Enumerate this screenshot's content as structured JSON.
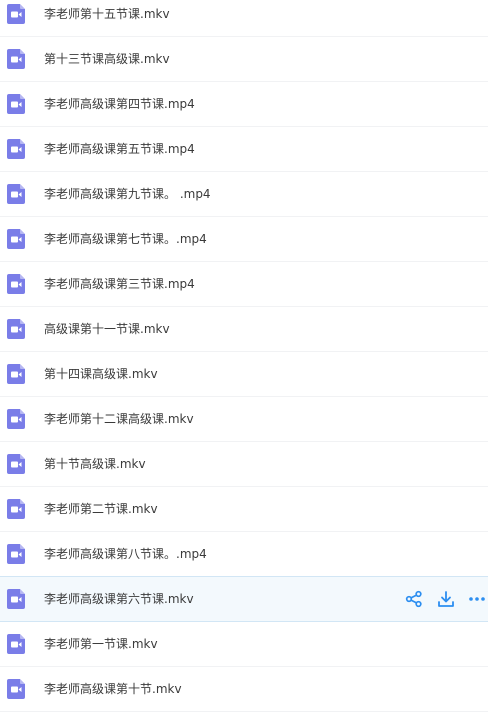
{
  "colors": {
    "file_icon": "#7a7de8",
    "action_icon": "#2c8ef0",
    "row_highlight_bg": "#f3f9fd",
    "row_highlight_border": "#d2e6f5",
    "text": "#3a3a3a"
  },
  "files": [
    {
      "name": "李老师第十五节课.mkv",
      "icon": "video-file-icon"
    },
    {
      "name": "第十三节课高级课.mkv",
      "icon": "video-file-icon"
    },
    {
      "name": "李老师高级课第四节课.mp4",
      "icon": "video-file-icon"
    },
    {
      "name": "李老师高级课第五节课.mp4",
      "icon": "video-file-icon"
    },
    {
      "name": "李老师高级课第九节课。 .mp4",
      "icon": "video-file-icon"
    },
    {
      "name": "李老师高级课第七节课。.mp4",
      "icon": "video-file-icon"
    },
    {
      "name": "李老师高级课第三节课.mp4",
      "icon": "video-file-icon"
    },
    {
      "name": "高级课第十一节课.mkv",
      "icon": "video-file-icon"
    },
    {
      "name": "第十四课高级课.mkv",
      "icon": "video-file-icon"
    },
    {
      "name": "李老师第十二课高级课.mkv",
      "icon": "video-file-icon"
    },
    {
      "name": "第十节高级课.mkv",
      "icon": "video-file-icon"
    },
    {
      "name": "李老师第二节课.mkv",
      "icon": "video-file-icon"
    },
    {
      "name": "李老师高级课第八节课。.mp4",
      "icon": "video-file-icon"
    },
    {
      "name": "李老师高级课第六节课.mkv",
      "icon": "video-file-icon",
      "hovered": true,
      "actions": [
        "share-icon",
        "download-icon",
        "more-icon"
      ]
    },
    {
      "name": "李老师第一节课.mkv",
      "icon": "video-file-icon"
    },
    {
      "name": "李老师高级课第十节.mkv",
      "icon": "video-file-icon"
    }
  ]
}
